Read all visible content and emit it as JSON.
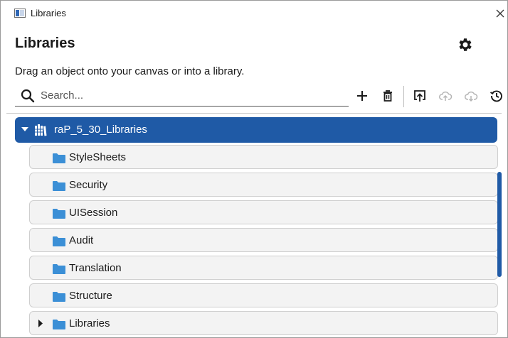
{
  "window": {
    "title": "Libraries",
    "close_icon": "close-icon",
    "app_icon": "window-app-icon"
  },
  "header": {
    "title": "Libraries",
    "settings_icon": "gear-icon",
    "subtitle": "Drag an object onto your canvas or into a library."
  },
  "search": {
    "placeholder": "Search...",
    "value": "",
    "icon": "search-icon"
  },
  "toolbar": {
    "items": [
      {
        "name": "add-button",
        "icon": "plus-icon",
        "enabled": true
      },
      {
        "name": "delete-button",
        "icon": "trash-icon",
        "enabled": true
      },
      {
        "name": "export-button",
        "icon": "export-icon",
        "enabled": true
      },
      {
        "name": "upload-button",
        "icon": "cloud-upload-icon",
        "enabled": false
      },
      {
        "name": "download-button",
        "icon": "cloud-download-icon",
        "enabled": false
      },
      {
        "name": "history-button",
        "icon": "history-icon",
        "enabled": true
      }
    ]
  },
  "tree": {
    "root": {
      "label": "raP_5_30_Libraries",
      "expanded": true,
      "selected": true,
      "icon": "library-icon"
    },
    "children": [
      {
        "label": "StyleSheets",
        "icon": "folder-icon",
        "has_children": false
      },
      {
        "label": "Security",
        "icon": "folder-icon",
        "has_children": false
      },
      {
        "label": "UISession",
        "icon": "folder-icon",
        "has_children": false
      },
      {
        "label": "Audit",
        "icon": "folder-icon",
        "has_children": false
      },
      {
        "label": "Translation",
        "icon": "folder-icon",
        "has_children": false
      },
      {
        "label": "Structure",
        "icon": "folder-icon",
        "has_children": false
      },
      {
        "label": "Libraries",
        "icon": "folder-icon",
        "has_children": true,
        "expanded": false
      }
    ]
  },
  "colors": {
    "accent": "#1f5aa6",
    "folder": "#3b8fd6",
    "row_bg": "#f3f3f3",
    "disabled_icon": "#b5b5b5"
  }
}
